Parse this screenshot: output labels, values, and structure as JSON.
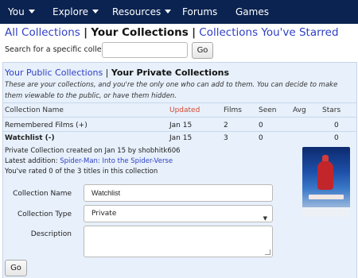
{
  "nav": {
    "items": [
      {
        "label": "You",
        "dropdown": true
      },
      {
        "label": "Explore",
        "dropdown": true
      },
      {
        "label": "Resources",
        "dropdown": true
      },
      {
        "label": "Forums",
        "dropdown": false
      },
      {
        "label": "Games",
        "dropdown": false
      }
    ]
  },
  "collections_nav": {
    "all": "All Collections",
    "yours": "Your Collections",
    "starred": "Collections You've Starred",
    "separator": "|"
  },
  "search": {
    "label": "Search for a specific collection",
    "value": "",
    "button": "Go"
  },
  "panel": {
    "public_link": "Your Public Collections",
    "separator": "|",
    "private_title": "Your Private Collections",
    "description": "These are your collections, and you're the only one who can add to them. You can decide to make them viewable to the public, or have them hidden.",
    "columns": {
      "name": "Collection Name",
      "updated": "Updated",
      "films": "Films",
      "seen": "Seen",
      "avg": "Avg",
      "stars": "Stars"
    },
    "rows": [
      {
        "name": "Remembered Films (+)",
        "updated": "Jan 15",
        "films": "2",
        "seen": "0",
        "avg": "",
        "stars": "0"
      },
      {
        "name": "Watchlist (-)",
        "updated": "Jan 15",
        "films": "3",
        "seen": "0",
        "avg": "",
        "stars": "0"
      }
    ],
    "details": {
      "created": "Private Collection created on Jan 15 by shobhitk606",
      "latest_prefix": "Latest addition: ",
      "latest_title": "Spider-Man: Into the Spider-Verse",
      "rated": "You've rated 0 of the 3 titles in this collection"
    },
    "form": {
      "name_label": "Collection Name",
      "name_value": "Watchlist",
      "type_label": "Collection Type",
      "type_value": "Private",
      "description_label": "Description",
      "description_value": "",
      "submit": "Go"
    }
  },
  "colors": {
    "nav_bg": "#0b2350",
    "link": "#2f3fc4",
    "updated_header": "#d24a33",
    "panel_bg": "#e7f0fb"
  }
}
